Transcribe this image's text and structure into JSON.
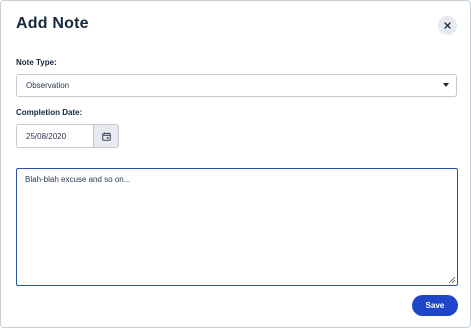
{
  "dialog": {
    "title": "Add Note",
    "close_icon": "close-icon"
  },
  "note_type": {
    "label": "Note Type:",
    "selected": "Observation",
    "icon": "chevron-down-icon"
  },
  "completion_date": {
    "label": "Completion Date:",
    "value": "25/08/2020",
    "icon": "calendar-icon"
  },
  "note_body": {
    "value": "Blah-blah excuse and so on..."
  },
  "actions": {
    "save_label": "Save"
  },
  "colors": {
    "primary": "#1f45c8",
    "title_text": "#16283b",
    "textarea_focus_border": "#2c55a0",
    "icon_bg": "#e7eaee"
  }
}
